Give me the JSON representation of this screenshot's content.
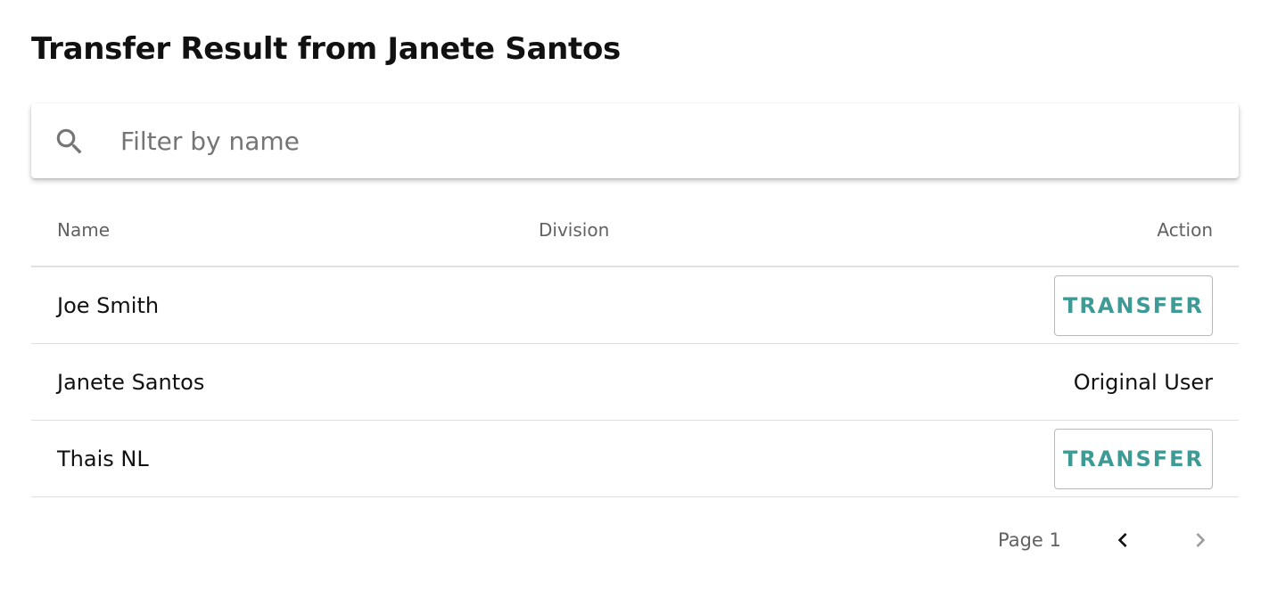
{
  "header": {
    "title": "Transfer Result from Janete Santos"
  },
  "search": {
    "placeholder": "Filter by name",
    "value": "",
    "icon": "search-icon"
  },
  "table": {
    "columns": {
      "name": "Name",
      "division": "Division",
      "action": "Action"
    },
    "rows": [
      {
        "name": "Joe Smith",
        "division": "",
        "action_type": "button",
        "action_label": "TRANSFER"
      },
      {
        "name": "Janete Santos",
        "division": "",
        "action_type": "text",
        "action_label": "Original User"
      },
      {
        "name": "Thais NL",
        "division": "",
        "action_type": "button",
        "action_label": "TRANSFER"
      }
    ]
  },
  "pagination": {
    "label": "Page 1",
    "prev_icon": "chevron-left-icon",
    "next_icon": "chevron-right-icon",
    "prev_enabled": true,
    "next_enabled": false
  },
  "colors": {
    "accent": "#3d9a94",
    "muted_text": "#616161",
    "divider": "#e0e0e0",
    "disabled_icon": "#9e9e9e"
  }
}
